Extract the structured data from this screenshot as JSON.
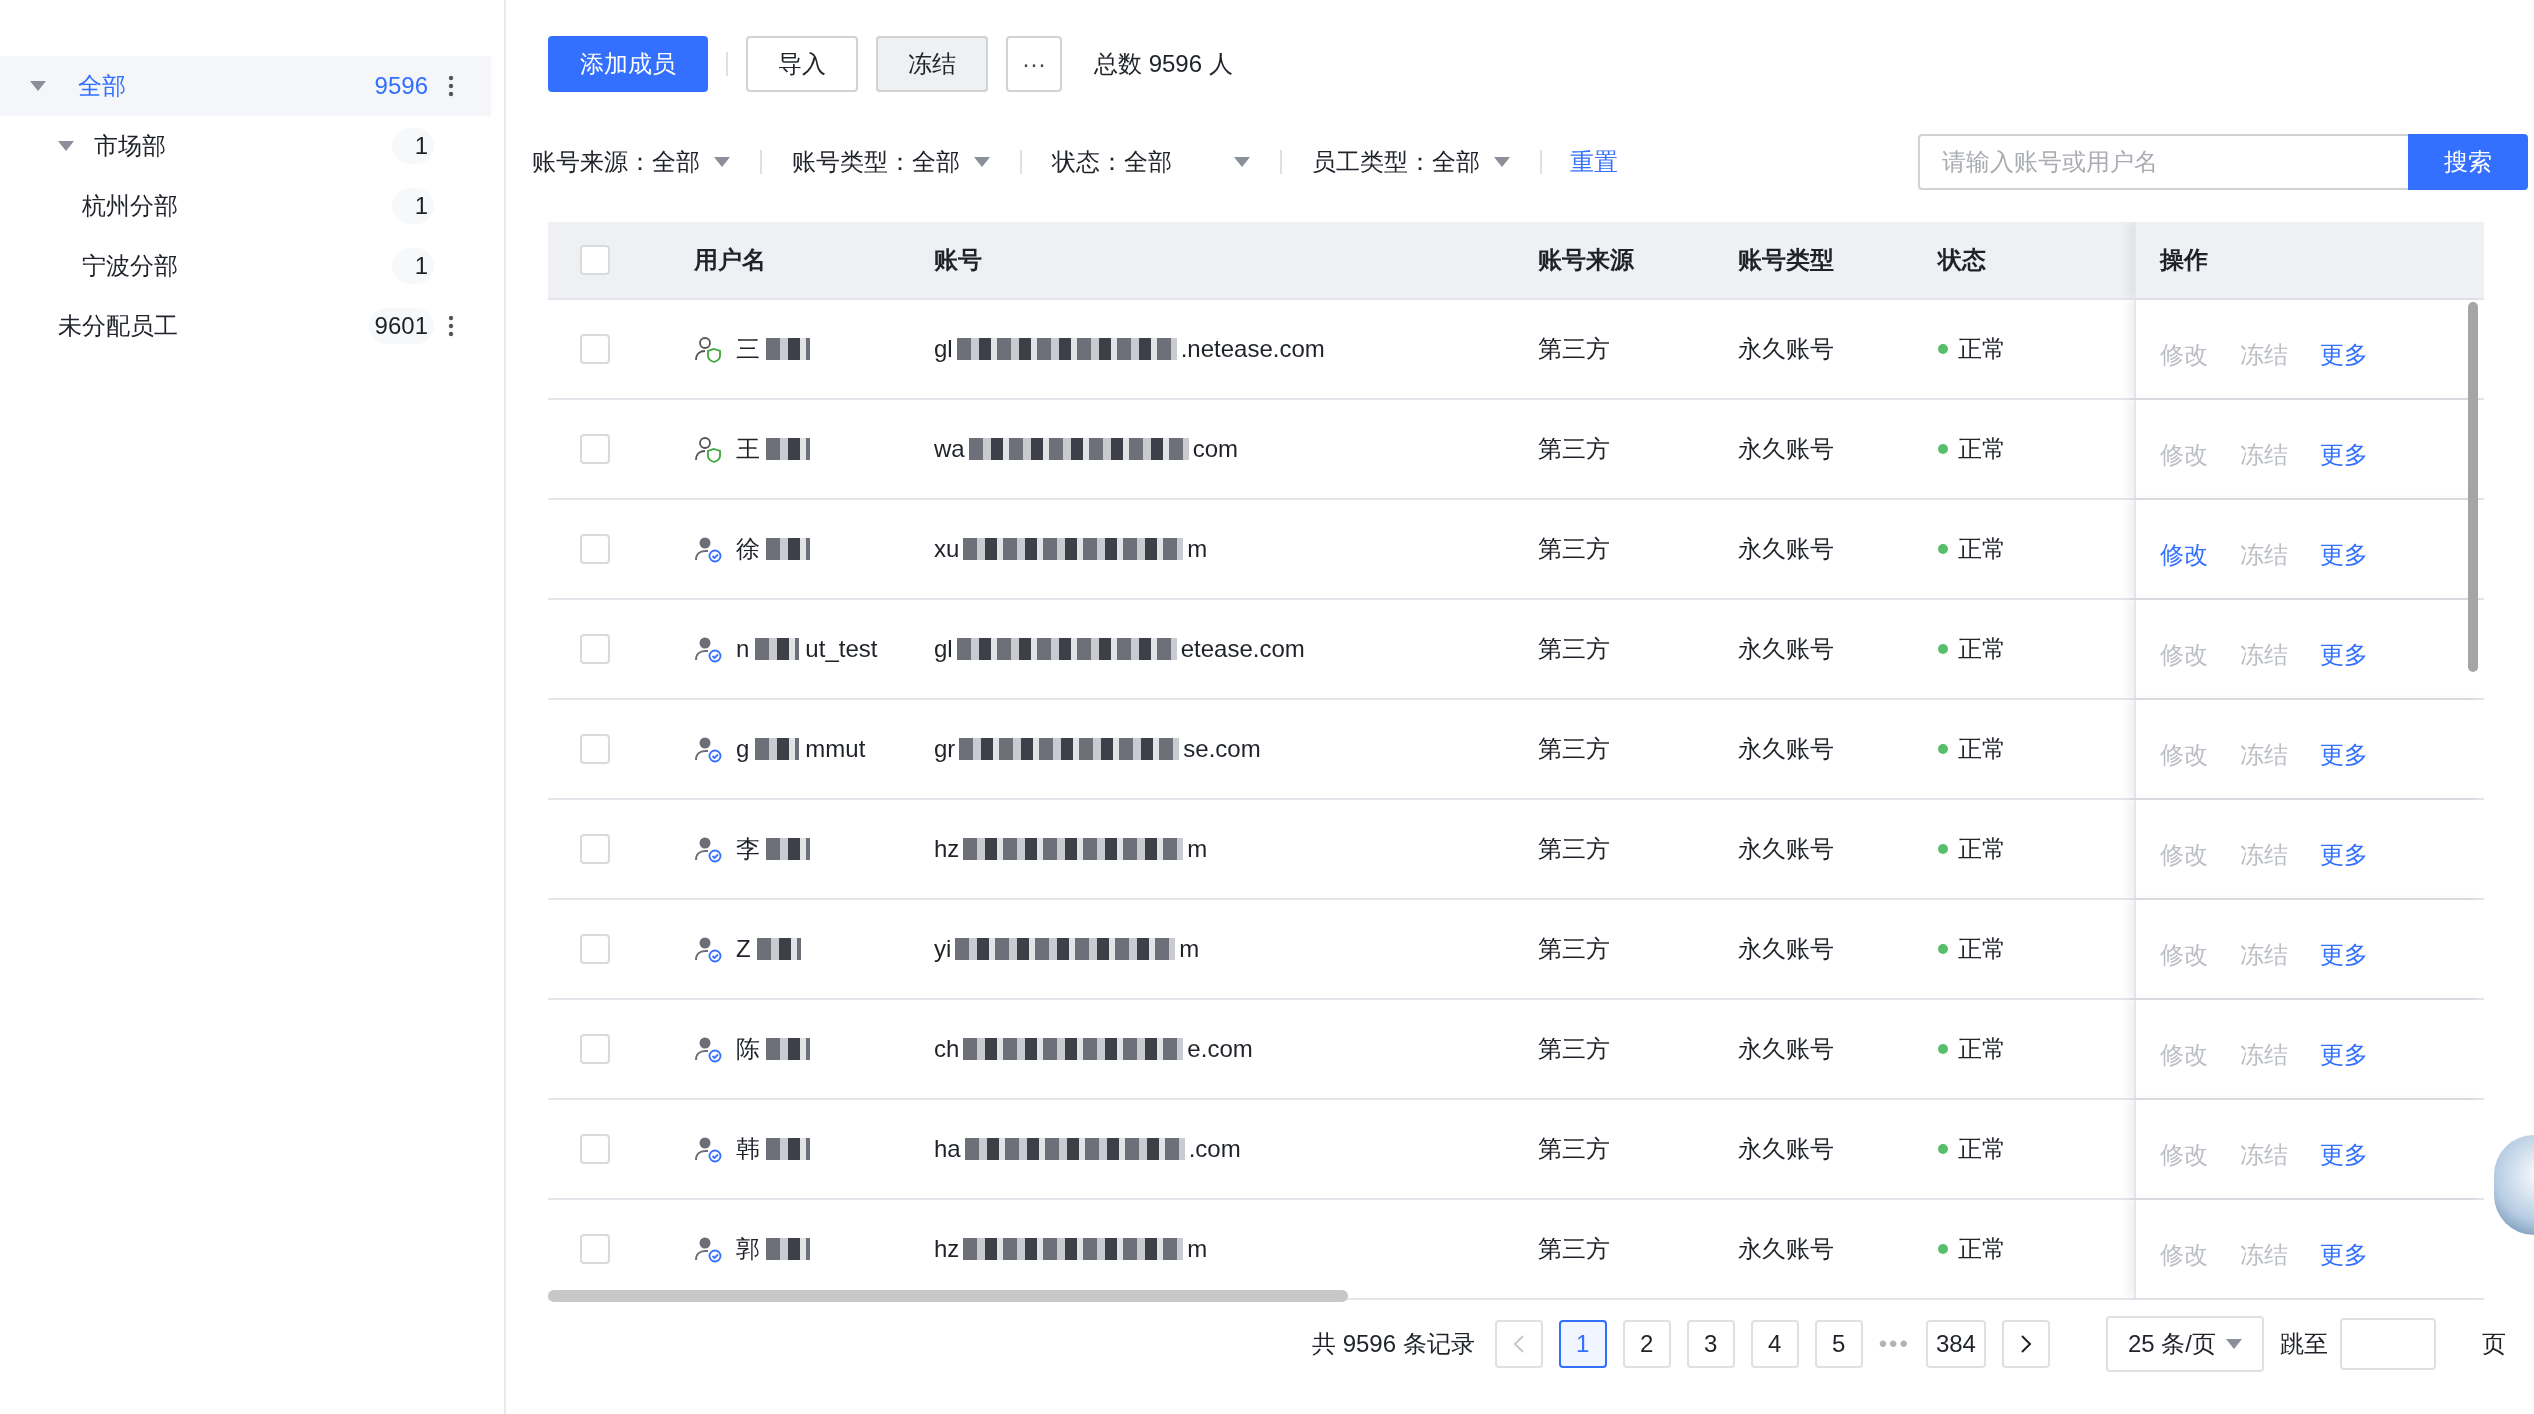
{
  "sidebar": {
    "tree": [
      {
        "label": "全部",
        "count": "9596",
        "selected": true,
        "expanded": true,
        "has_menu": true,
        "children": [
          {
            "label": "市场部",
            "count": "1",
            "selected": false,
            "expanded": true,
            "has_menu": false,
            "children": [
              {
                "label": "杭州分部",
                "count": "1",
                "selected": false,
                "has_menu": false
              },
              {
                "label": "宁波分部",
                "count": "1",
                "selected": false,
                "has_menu": false
              }
            ]
          }
        ]
      },
      {
        "label": "未分配员工",
        "count": "9601",
        "selected": false,
        "has_menu": true
      }
    ]
  },
  "toolbar": {
    "buttons": [
      {
        "label": "添加成员",
        "kind": "primary"
      },
      {
        "label": "导入",
        "kind": "default"
      },
      {
        "label": "冻结",
        "kind": "muted"
      },
      {
        "label": "···",
        "kind": "more"
      }
    ],
    "total": "总数 9596 人"
  },
  "filters": {
    "items": [
      {
        "label": "账号来源：",
        "value": "全部"
      },
      {
        "label": "账号类型：",
        "value": "全部"
      },
      {
        "label": "状态：",
        "value": "全部"
      },
      {
        "label": "员工类型：",
        "value": "全部"
      }
    ],
    "reset": "重置",
    "search": {
      "placeholder": "请输入账号或用户名",
      "button": "搜索"
    }
  },
  "table": {
    "select_all_checked": false,
    "columns": [
      "用户名",
      "账号",
      "账号来源",
      "账号类型",
      "状态",
      "操作"
    ],
    "rows": [
      {
        "checked": false,
        "kind": "guard",
        "name_start": "三",
        "name_end": "",
        "account_start": "gl",
        "account_end": ".netease.com",
        "source": "第三方",
        "type": "永久账号",
        "status": "正常",
        "actions": [
          {
            "label": "修改",
            "disabled": true
          },
          {
            "label": "冻结",
            "disabled": true
          },
          {
            "label": "更多",
            "disabled": false
          }
        ]
      },
      {
        "checked": false,
        "kind": "guard",
        "name_start": "王",
        "name_end": "",
        "account_start": "wa",
        "account_end": "com",
        "source": "第三方",
        "type": "永久账号",
        "status": "正常",
        "actions": [
          {
            "label": "修改",
            "disabled": true
          },
          {
            "label": "冻结",
            "disabled": true
          },
          {
            "label": "更多",
            "disabled": false
          }
        ]
      },
      {
        "checked": false,
        "kind": "verified",
        "name_start": "徐",
        "name_end": "",
        "account_start": "xu",
        "account_end": "m",
        "source": "第三方",
        "type": "永久账号",
        "status": "正常",
        "actions": [
          {
            "label": "修改",
            "disabled": false
          },
          {
            "label": "冻结",
            "disabled": true
          },
          {
            "label": "更多",
            "disabled": false
          }
        ]
      },
      {
        "checked": false,
        "kind": "verified",
        "name_start": "n",
        "name_end": "ut_test",
        "account_start": "gl",
        "account_end": "etease.com",
        "source": "第三方",
        "type": "永久账号",
        "status": "正常",
        "actions": [
          {
            "label": "修改",
            "disabled": true
          },
          {
            "label": "冻结",
            "disabled": true
          },
          {
            "label": "更多",
            "disabled": false
          }
        ]
      },
      {
        "checked": false,
        "kind": "verified",
        "name_start": "g",
        "name_end": "mmut",
        "account_start": "gr",
        "account_end": "se.com",
        "source": "第三方",
        "type": "永久账号",
        "status": "正常",
        "actions": [
          {
            "label": "修改",
            "disabled": true
          },
          {
            "label": "冻结",
            "disabled": true
          },
          {
            "label": "更多",
            "disabled": false
          }
        ]
      },
      {
        "checked": false,
        "kind": "verified",
        "name_start": "李",
        "name_end": "",
        "account_start": "hz",
        "account_end": "m",
        "source": "第三方",
        "type": "永久账号",
        "status": "正常",
        "actions": [
          {
            "label": "修改",
            "disabled": true
          },
          {
            "label": "冻结",
            "disabled": true
          },
          {
            "label": "更多",
            "disabled": false
          }
        ]
      },
      {
        "checked": false,
        "kind": "verified",
        "name_start": "Z",
        "name_end": "",
        "account_start": "yi",
        "account_end": "m",
        "source": "第三方",
        "type": "永久账号",
        "status": "正常",
        "actions": [
          {
            "label": "修改",
            "disabled": true
          },
          {
            "label": "冻结",
            "disabled": true
          },
          {
            "label": "更多",
            "disabled": false
          }
        ]
      },
      {
        "checked": false,
        "kind": "verified",
        "name_start": "陈",
        "name_end": "",
        "account_start": "ch",
        "account_end": "e.com",
        "source": "第三方",
        "type": "永久账号",
        "status": "正常",
        "actions": [
          {
            "label": "修改",
            "disabled": true
          },
          {
            "label": "冻结",
            "disabled": true
          },
          {
            "label": "更多",
            "disabled": false
          }
        ]
      },
      {
        "checked": false,
        "kind": "verified",
        "name_start": "韩",
        "name_end": "",
        "account_start": "ha",
        "account_end": ".com",
        "source": "第三方",
        "type": "永久账号",
        "status": "正常",
        "actions": [
          {
            "label": "修改",
            "disabled": true
          },
          {
            "label": "冻结",
            "disabled": true
          },
          {
            "label": "更多",
            "disabled": false
          }
        ]
      },
      {
        "checked": false,
        "kind": "verified",
        "name_start": "郭",
        "name_end": "",
        "account_start": "hz",
        "account_end": "m",
        "source": "第三方",
        "type": "永久账号",
        "status": "正常",
        "actions": [
          {
            "label": "修改",
            "disabled": true
          },
          {
            "label": "冻结",
            "disabled": true
          },
          {
            "label": "更多",
            "disabled": false
          }
        ]
      }
    ]
  },
  "pagination": {
    "total": "共 9596 条记录",
    "prev_disabled": true,
    "pages": [
      {
        "label": "1",
        "kind": "page",
        "selected": true
      },
      {
        "label": "2",
        "kind": "page",
        "selected": false
      },
      {
        "label": "3",
        "kind": "page",
        "selected": false
      },
      {
        "label": "4",
        "kind": "page",
        "selected": false
      },
      {
        "label": "5",
        "kind": "page",
        "selected": false
      },
      {
        "label": "•••",
        "kind": "ellipsis"
      },
      {
        "label": "384",
        "kind": "page",
        "selected": false
      }
    ],
    "page_size": "25 条/页",
    "jump_label": "跳至",
    "jump_suffix": "页"
  }
}
